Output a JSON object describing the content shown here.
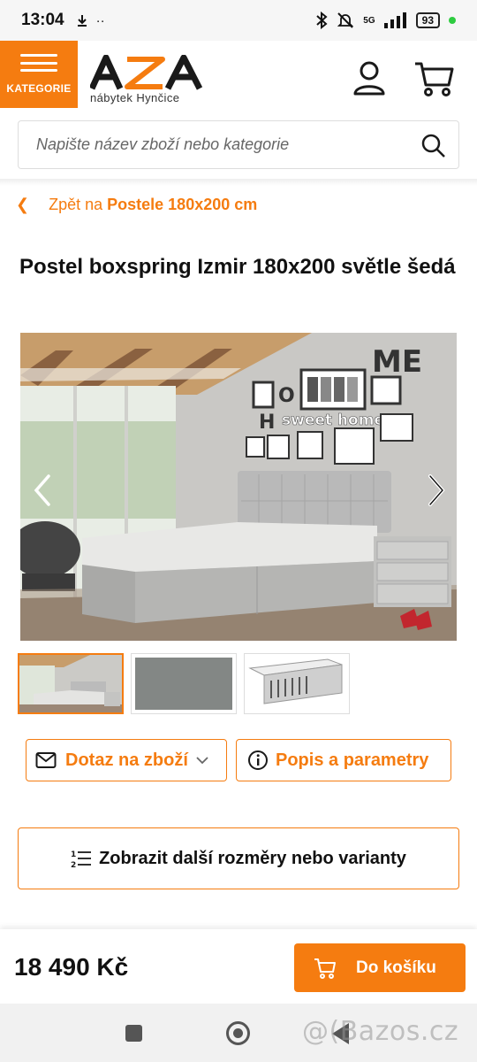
{
  "status_bar": {
    "time": "13:04",
    "network": "5G",
    "battery": "93"
  },
  "header": {
    "categories_label": "KATEGORIE",
    "logo_text": "AZA",
    "logo_subtitle": "nábytek Hynčice",
    "accent_color": "#f57c10"
  },
  "search": {
    "placeholder": "Napište název zboží nebo kategorie"
  },
  "breadcrumb": {
    "prefix": "Zpět na",
    "category": "Postele 180x200 cm"
  },
  "product": {
    "title": "Postel boxspring Izmir 180x200 světle šedá",
    "price": "18 490 Kč",
    "image_wall_text": "sweet home",
    "image_wall_letters": "ME",
    "image_wall_letters_2": "O",
    "image_wall_letters_3": "H",
    "thumbnails": [
      "room",
      "fabric",
      "mattress-detail"
    ]
  },
  "actions": {
    "inquiry_label": "Dotaz na zboží",
    "description_label": "Popis a parametry",
    "variants_label": "Zobrazit další rozměry nebo varianty",
    "add_to_cart_label": "Do košíku"
  },
  "watermark": "@(Bazos.cz"
}
